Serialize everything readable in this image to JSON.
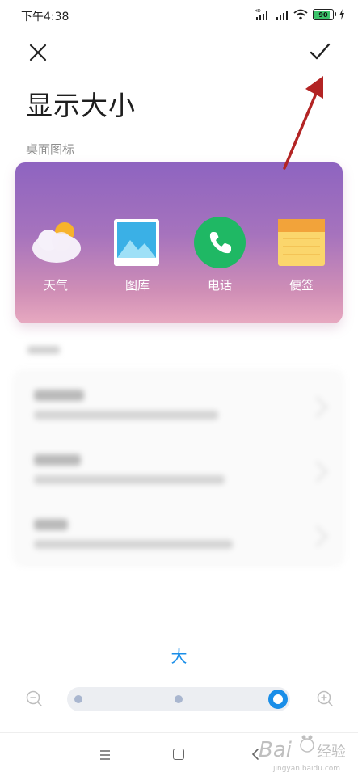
{
  "status_bar": {
    "time": "下午4:38",
    "signal_badge": "HD",
    "battery": "90"
  },
  "header": {
    "title": "显示大小",
    "close_icon": "close-icon",
    "confirm_icon": "checkmark-icon"
  },
  "preview": {
    "section_label": "桌面图标",
    "apps": [
      {
        "label": "天气",
        "icon": "weather-icon"
      },
      {
        "label": "图库",
        "icon": "gallery-icon"
      },
      {
        "label": "电话",
        "icon": "phone-icon"
      },
      {
        "label": "便签",
        "icon": "notes-icon"
      }
    ]
  },
  "size_control": {
    "current_label": "大",
    "levels": 3,
    "selected_level": 3,
    "zoom_out_icon": "zoom-out-icon",
    "zoom_in_icon": "zoom-in-icon"
  },
  "nav": {
    "menu_icon": "menu-icon",
    "home_icon": "home-icon",
    "back_icon": "back-icon"
  },
  "watermark": {
    "text": "jingyan.baidu.com"
  },
  "colors": {
    "accent": "#1a8ee8",
    "card_top": "#8e64c0",
    "card_bottom": "#e7a9c0",
    "annotation": "#b32424"
  }
}
